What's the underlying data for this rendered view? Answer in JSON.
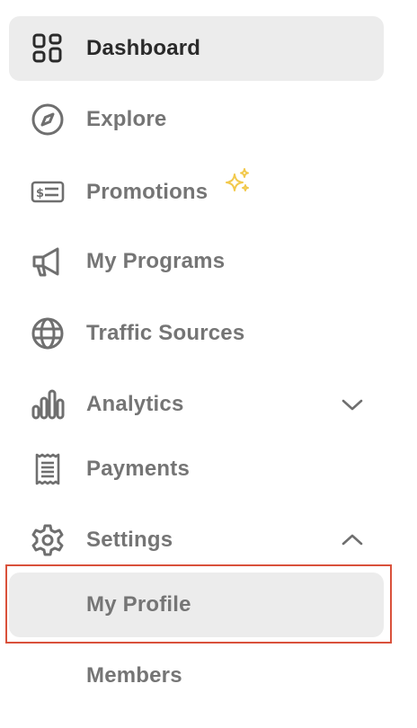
{
  "nav": {
    "items": [
      {
        "label": "Dashboard",
        "icon": "dashboard-grid-icon",
        "active": true
      },
      {
        "label": "Explore",
        "icon": "compass-icon"
      },
      {
        "label": "Promotions",
        "icon": "dollar-bill-icon",
        "badge_icon": "sparkle-icon",
        "badge_color": "#f2c94c"
      },
      {
        "label": "My Programs",
        "icon": "megaphone-icon"
      },
      {
        "label": "Traffic Sources",
        "icon": "globe-icon"
      },
      {
        "label": "Analytics",
        "icon": "bar-chart-icon",
        "chevron": "chevron-down-icon"
      },
      {
        "label": "Payments",
        "icon": "receipt-icon"
      },
      {
        "label": "Settings",
        "icon": "gear-icon",
        "chevron": "chevron-up-icon",
        "expanded": true
      }
    ],
    "settings_children": [
      {
        "label": "My Profile",
        "selected": true
      },
      {
        "label": "Members"
      }
    ]
  },
  "colors": {
    "text_active": "#2a2a2a",
    "text_default": "#757575",
    "icon_stroke": "#6f6f6f",
    "active_bg": "#ececec",
    "highlight_border": "#d9513b",
    "sparkle": "#f2c94c"
  }
}
